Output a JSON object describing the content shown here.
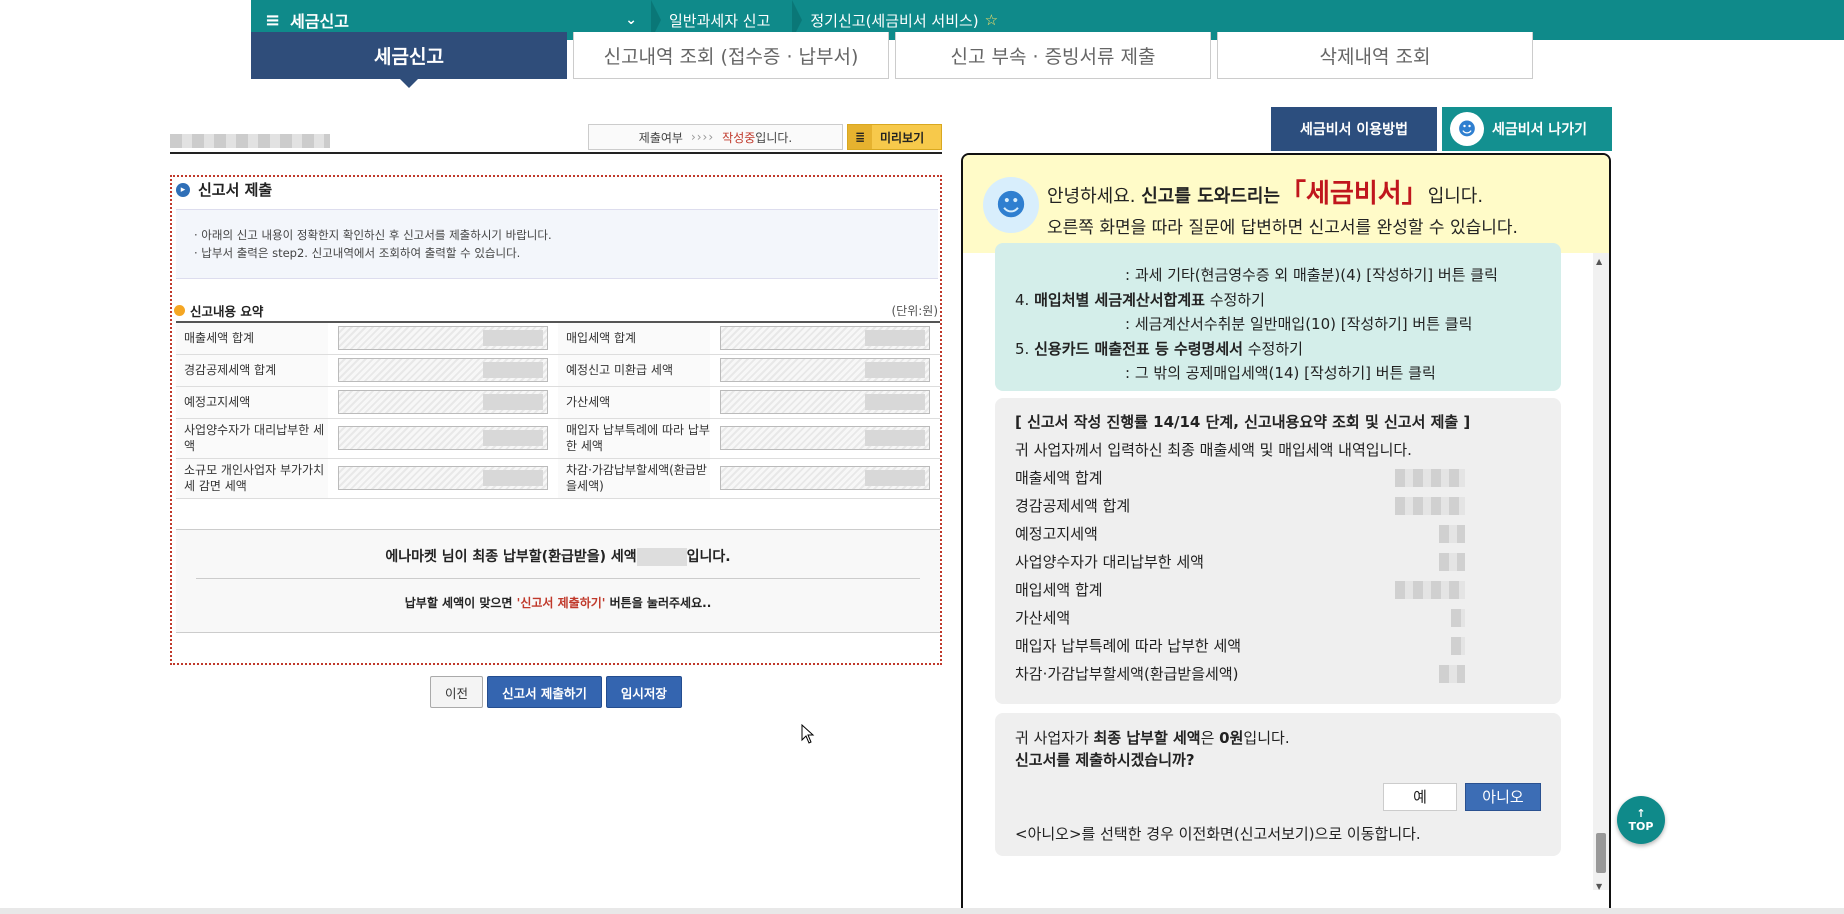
{
  "topbar": {
    "menu_label": "세금신고",
    "crumb1": "일반과세자 신고",
    "crumb2": "정기신고(세금비서 서비스)"
  },
  "tabs": [
    {
      "label": "세금신고"
    },
    {
      "label": "신고내역 조회 (접수증 · 납부서)"
    },
    {
      "label": "신고 부속 · 증빙서류 제출"
    },
    {
      "label": "삭제내역 조회"
    }
  ],
  "status": {
    "label": "제출여부",
    "arrows": "››››",
    "state": "작성중",
    "suffix": "입니다.",
    "preview": "미리보기"
  },
  "section": {
    "title": "신고서 제출",
    "notice1": "· 아래의 신고 내용이 정확한지 확인하신 후 신고서를 제출하시기 바랍니다.",
    "notice2": "· 납부서 출력은 step2. 신고내역에서 조회하여 출력할 수 있습니다."
  },
  "summary": {
    "title": "신고내용 요약",
    "unit": "(단위:원)",
    "rows": [
      [
        "매출세액 합계",
        "매입세액 합계"
      ],
      [
        "경감공제세액 합계",
        "예정신고 미환급 세액"
      ],
      [
        "예정고지세액",
        "가산세액"
      ],
      [
        "사업양수자가 대리납부한 세액",
        "매입자 납부특례에 따라 납부한 세액"
      ],
      [
        "소규모 개인사업자 부가가치세 감면 세액",
        "차감·가감납부할세액(환급받을세액)"
      ]
    ]
  },
  "final": {
    "msg_a": "에나마켓 님이 최종 납부할(환급받을) 세액",
    "msg_b": "입니다.",
    "sub_a": "납부할 세액이 맞으면 ",
    "sub_red": "'신고서 제출하기'",
    "sub_b": " 버튼을 눌러주세요.."
  },
  "buttons": {
    "prev": "이전",
    "submit": "신고서 제출하기",
    "save": "임시저장"
  },
  "assistant": {
    "help": "세금비서 이용방법",
    "exit": "세금비서 나가기",
    "greet_a": "안녕하세요. ",
    "greet_b": "신고를 도와드리는",
    "brand": "「세금비서」",
    "greet_c": "입니다.",
    "greet2": "오른쪽 화면을 따라 질문에 답변하면 신고서를 완성할 수 있습니다.",
    "step_tail": ": 과세 기타(현금영수증 외 매출분)(4) [작성하기] 버튼 클릭",
    "step4_num": "4. ",
    "step4_bold": "매입처별 세금계산서합계표",
    "step4_rest": " 수정하기",
    "step4_sub": ": 세금계산서수취분 일반매입(10) [작성하기] 버튼 클릭",
    "step5_num": "5. ",
    "step5_bold": "신용카드 매출전표 등 수령명세서",
    "step5_rest": " 수정하기",
    "step5_sub": ": 그 밖의 공제매입세액(14) [작성하기] 버튼 클릭",
    "progress_title": "[ 신고서 작성 진행률 14/14 단계, 신고내용요약 조회 및 신고서 제출 ]",
    "progress_desc": "귀 사업자께서 입력하신 최종 매출세액 및 매입세액 내역입니다.",
    "items": [
      "매출세액 합계",
      "경감공제세액 합계",
      "예정고지세액",
      "사업양수자가 대리납부한 세액",
      "매입세액 합계",
      "가산세액",
      "매입자 납부특례에 따라 납부한 세액",
      "차감·가감납부할세액(환급받을세액)"
    ],
    "final_a": "귀 사업자가 ",
    "final_b": "최종 납부할 세액",
    "final_c": "은 ",
    "final_d": "0원",
    "final_e": "입니다.",
    "question": "신고서를 제출하시겠습니까?",
    "yes": "예",
    "no": "아니오",
    "note": "<아니오>를 선택한 경우 이전화면(신고서보기)으로 이동합니다."
  },
  "fab": {
    "arrow": "↑",
    "label": "TOP"
  }
}
